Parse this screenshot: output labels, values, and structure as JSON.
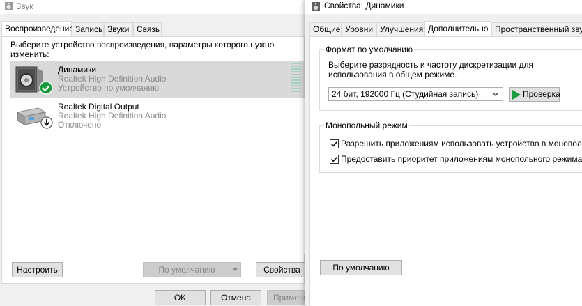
{
  "sound_window": {
    "title": "Звук",
    "tabs": [
      "Воспроизведение",
      "Запись",
      "Звуки",
      "Связь"
    ],
    "description": "Выберите устройство воспроизведения, параметры которого нужно изменить:",
    "devices": [
      {
        "name": "Динамики",
        "driver": "Realtek High Definition Audio",
        "status": "Устройство по умолчанию",
        "selected": true,
        "badge": "check-badge-icon"
      },
      {
        "name": "Realtek Digital Output",
        "driver": "Realtek High Definition Audio",
        "status": "Отключено",
        "selected": false,
        "badge": "disabled-arrow-badge-icon"
      }
    ],
    "buttons": {
      "configure": "Настроить",
      "set_default": "По умолчанию",
      "properties": "Свойства"
    },
    "footer": {
      "ok": "OK",
      "cancel": "Отмена",
      "apply": "Примени"
    }
  },
  "props_window": {
    "title": "Свойства: Динамики",
    "tabs": [
      "Общие",
      "Уровни",
      "Улучшения",
      "Дополнительно",
      "Пространственный звук"
    ],
    "active_tab": "Дополнительно",
    "default_format": {
      "legend": "Формат по умолчанию",
      "description": "Выберите разрядность и частоту дискретизации для использования в общем режиме.",
      "selected_value": "24 бит, 192000 Гц (Студийная запись)",
      "test_button": "Проверка"
    },
    "exclusive_mode": {
      "legend": "Монопольный режим",
      "options": [
        {
          "label": "Разрешить приложениям использовать устройство в монопольн",
          "checked": true
        },
        {
          "label": "Предоставить приоритет приложениям монопольного режима",
          "checked": true
        }
      ]
    },
    "restore_default_button": "По умолчанию"
  },
  "colors": {
    "selection": "#d9d9d9",
    "accent_green": "#1a9c3e",
    "meter": "#a8cfc5"
  }
}
